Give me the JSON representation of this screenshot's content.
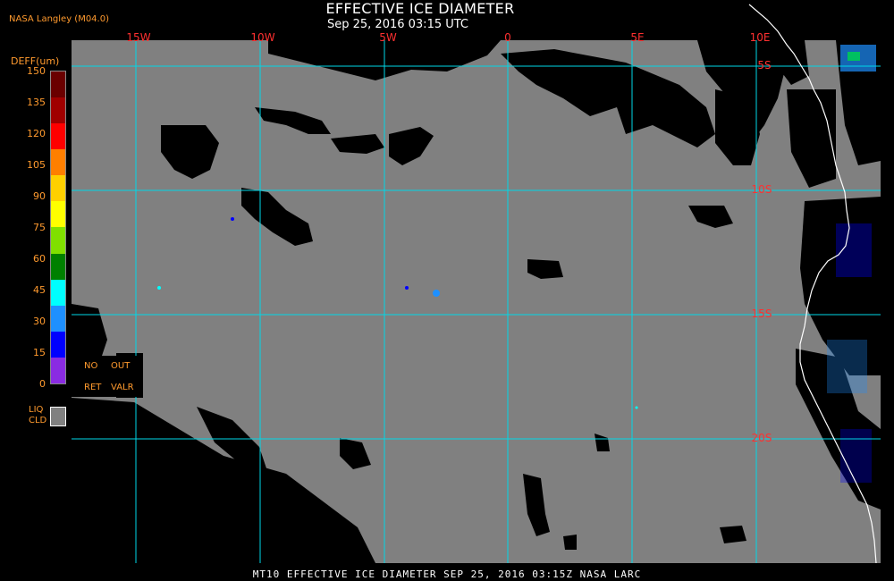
{
  "header": {
    "title": "EFFECTIVE ICE DIAMETER",
    "subtitle": "Sep 25, 2016 03:15 UTC",
    "producer": "NASA Langley (M04.0)"
  },
  "map": {
    "longitude_labels": [
      "15W",
      "10W",
      "5W",
      "0",
      "5E",
      "10E"
    ],
    "latitude_labels": [
      "5S",
      "10S",
      "15S",
      "20S"
    ],
    "colors": {
      "background": "#000000",
      "liquid_cloud": "#808080",
      "grid": "#00d8e8",
      "grid_label": "#ff3030",
      "coastline": "#ffffff"
    }
  },
  "legend": {
    "title": "DEFF(um)",
    "ticks": [
      "150",
      "135",
      "120",
      "105",
      "90",
      "75",
      "60",
      "45",
      "30",
      "15",
      "0"
    ],
    "color_steps": [
      "#6a0000",
      "#a00000",
      "#ff0000",
      "#ff7f00",
      "#ffd000",
      "#ffff00",
      "#80e000",
      "#008000",
      "#00ffff",
      "#1e90ff",
      "#0000ff",
      "#8a2be2"
    ],
    "no_retrieval": {
      "line1a": "NO",
      "line1b": "OUT",
      "line2a": "RET",
      "line2b": "VALR"
    },
    "liquid_cloud": {
      "line1": "LIQ",
      "line2": "CLD",
      "color": "#808080"
    }
  },
  "footer": {
    "text": "MT10  EFFECTIVE ICE DIAMETER   SEP 25, 2016 03:15Z   NASA LARC"
  }
}
